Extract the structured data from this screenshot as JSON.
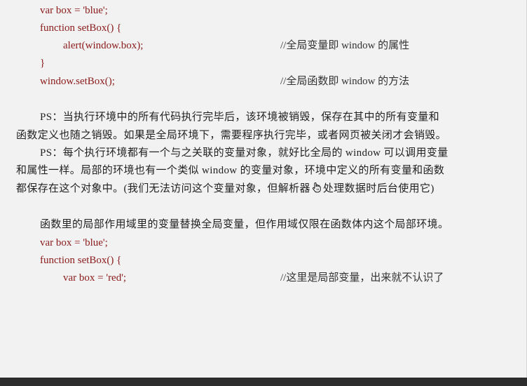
{
  "code_block_1": {
    "line1": "var box = 'blue';",
    "line2": "function setBox() {",
    "line3": "alert(window.box);",
    "line3_comment": "//全局变量即 window 的属性",
    "line4": "}",
    "line5": "window.setBox();",
    "line5_comment": "//全局函数即 window 的方法"
  },
  "paragraphs": {
    "ps1_line1": "PS：当执行环境中的所有代码执行完毕后，该环境被销毁，保存在其中的所有变量和",
    "ps1_line2": "函数定义也随之销毁。如果是全局环境下，需要程序执行完毕，或者网页被关闭才会销毁。",
    "ps2_line1": "PS：每个执行环境都有一个与之关联的变量对象，就好比全局的 window 可以调用变量",
    "ps2_line2": "和属性一样。局部的环境也有一个类似 window  的变量对象，环境中定义的所有变量和函数",
    "ps2_line3_part1": "都保存在这个对象中。(我们无法访问这个变量对象，但解析器",
    "ps2_line3_part2": "处理数据时后台使用它)",
    "intro": "函数里的局部作用域里的变量替换全局变量，但作用域仅限在函数体内这个局部环境。"
  },
  "code_block_2": {
    "line1": "var box = 'blue';",
    "line2": "function setBox() {",
    "line3": "var box = 'red';",
    "line3_comment": "//这里是局部变量，出来就不认识了"
  },
  "icons": {
    "cursor": "hand-cursor-icon"
  },
  "colors": {
    "code": "#8b1a1a",
    "text": "#222222",
    "background": "#f2f2f2"
  }
}
